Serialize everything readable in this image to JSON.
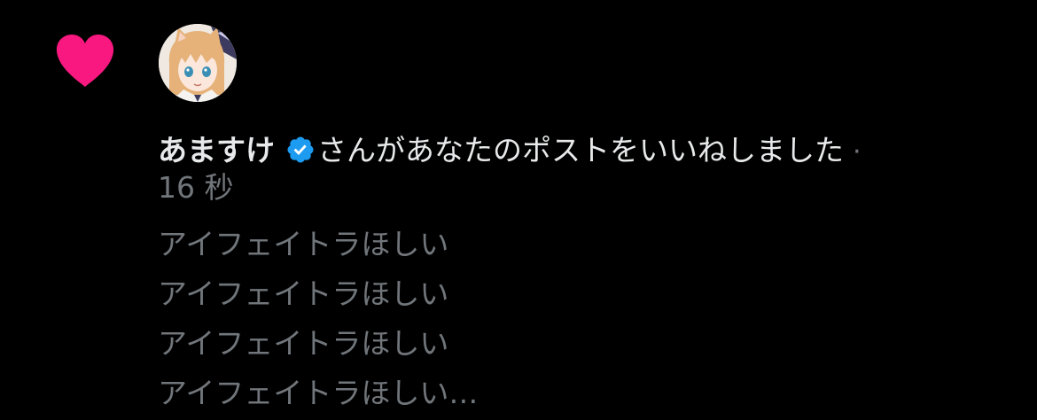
{
  "notification": {
    "type_icon": "heart-icon",
    "heart_color": "#f91880",
    "user": {
      "avatar": "anime-avatar",
      "name": "あますけ",
      "verified": true,
      "verified_color": "#1d9bf0"
    },
    "action_text": "さんがあなたのポストをいいねしました",
    "separator": "·",
    "time": "16 秒",
    "post_lines": [
      "アイフェイトラほしい",
      "アイフェイトラほしい",
      "アイフェイトラほしい",
      "アイフェイトラほしい…"
    ]
  }
}
